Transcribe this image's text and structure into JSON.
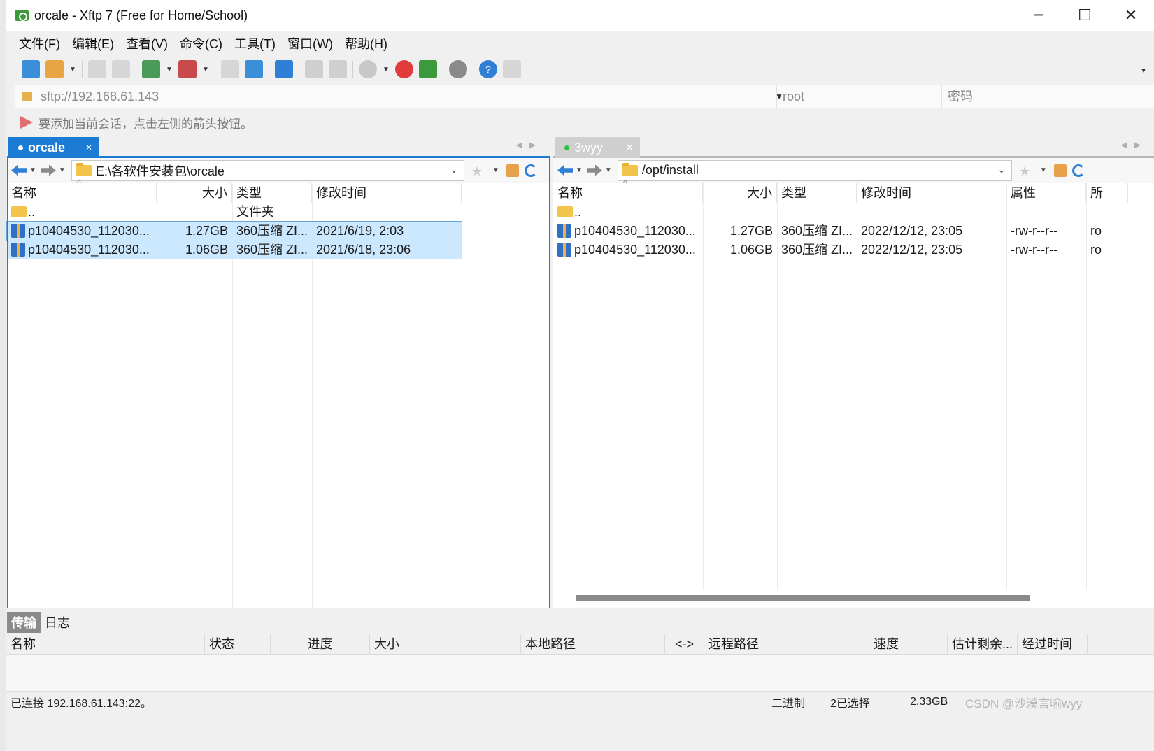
{
  "window": {
    "title": "orcale - Xftp 7 (Free for Home/School)",
    "minimize": "─",
    "maximize": "☐",
    "close": "✕"
  },
  "menu": [
    "文件(F)",
    "编辑(E)",
    "查看(V)",
    "命令(C)",
    "工具(T)",
    "窗口(W)",
    "帮助(H)"
  ],
  "address": {
    "url": "sftp://192.168.61.143",
    "user": "root",
    "password_placeholder": "密码"
  },
  "hint": "要添加当前会话，点击左侧的箭头按钮。",
  "left_pane": {
    "tab": "orcale",
    "path": "E:\\各软件安装包\\orcale",
    "columns": [
      "名称",
      "大小",
      "类型",
      "修改时间"
    ],
    "rows": [
      {
        "name": "..",
        "size": "",
        "type": "文件夹",
        "modified": ""
      },
      {
        "name": "p10404530_112030...",
        "size": "1.27GB",
        "type": "360压缩 ZI...",
        "modified": "2021/6/19, 2:03"
      },
      {
        "name": "p10404530_112030...",
        "size": "1.06GB",
        "type": "360压缩 ZI...",
        "modified": "2021/6/18, 23:06"
      }
    ]
  },
  "right_pane": {
    "tab": "3wyy",
    "path": "/opt/install",
    "columns": [
      "名称",
      "大小",
      "类型",
      "修改时间",
      "属性",
      "所"
    ],
    "rows": [
      {
        "name": "..",
        "size": "",
        "type": "",
        "modified": "",
        "attr": "",
        "owner": ""
      },
      {
        "name": "p10404530_112030...",
        "size": "1.27GB",
        "type": "360压缩 ZI...",
        "modified": "2022/12/12, 23:05",
        "attr": "-rw-r--r--",
        "owner": "ro"
      },
      {
        "name": "p10404530_112030...",
        "size": "1.06GB",
        "type": "360压缩 ZI...",
        "modified": "2022/12/12, 23:05",
        "attr": "-rw-r--r--",
        "owner": "ro"
      }
    ]
  },
  "transfer": {
    "tabs": [
      "传输",
      "日志"
    ],
    "columns": [
      "名称",
      "状态",
      "进度",
      "大小",
      "本地路径",
      "<->",
      "远程路径",
      "速度",
      "估计剩余...",
      "经过时间"
    ]
  },
  "status": {
    "connection": "已连接 192.168.61.143:22。",
    "mode": "二进制",
    "selected": "2已选择",
    "size": "2.33GB"
  },
  "watermark": "CSDN @沙漠言喻wyy",
  "colors": {
    "accent": "#1c7bd4",
    "selection": "#cce8ff"
  }
}
